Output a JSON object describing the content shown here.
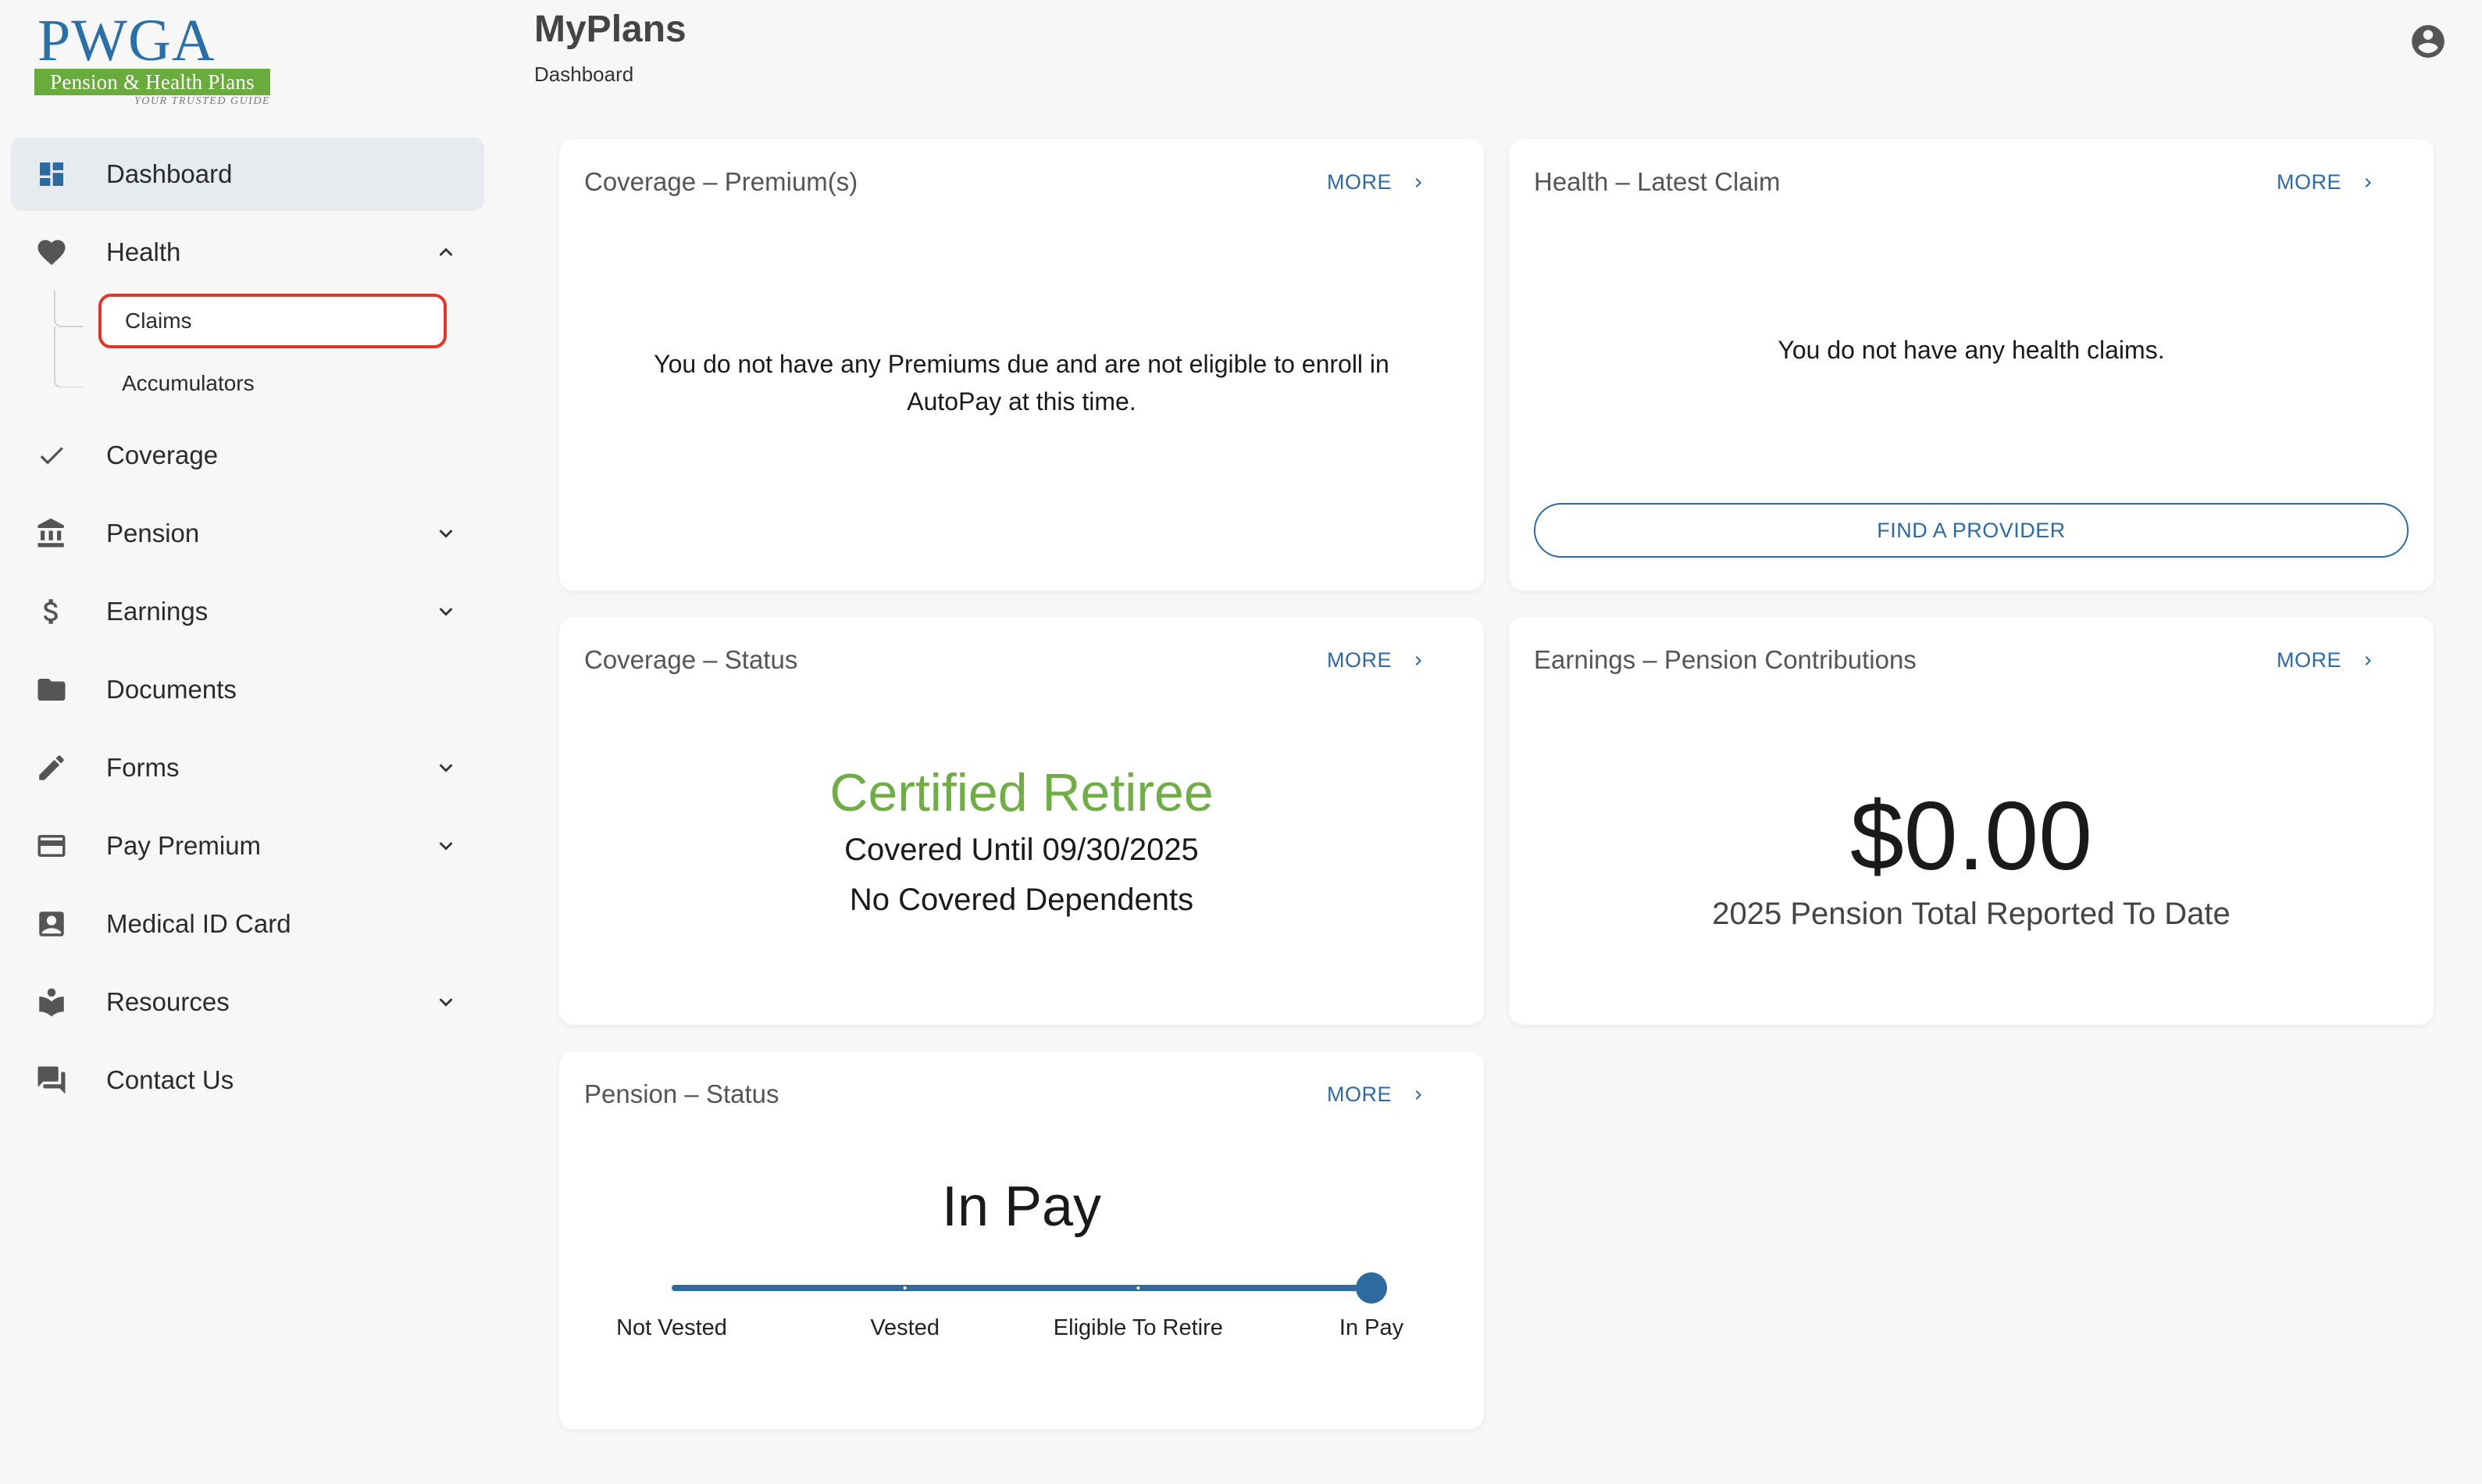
{
  "logo": {
    "main": "PWGA",
    "band": "Pension & Health Plans",
    "tagline": "YOUR TRUSTED GUIDE"
  },
  "header": {
    "title": "MyPlans",
    "breadcrumb": "Dashboard"
  },
  "sidebar": {
    "items": [
      {
        "label": "Dashboard",
        "icon": "dashboard-icon",
        "active": true
      },
      {
        "label": "Health",
        "icon": "heart-icon",
        "expanded": true,
        "children": [
          {
            "label": "Claims",
            "highlighted": true
          },
          {
            "label": "Accumulators"
          }
        ]
      },
      {
        "label": "Coverage",
        "icon": "check-icon"
      },
      {
        "label": "Pension",
        "icon": "bank-icon",
        "expandable": true
      },
      {
        "label": "Earnings",
        "icon": "dollar-icon",
        "expandable": true
      },
      {
        "label": "Documents",
        "icon": "folder-icon"
      },
      {
        "label": "Forms",
        "icon": "pencil-icon",
        "expandable": true
      },
      {
        "label": "Pay Premium",
        "icon": "credit-card-icon",
        "expandable": true
      },
      {
        "label": "Medical ID Card",
        "icon": "id-card-icon"
      },
      {
        "label": "Resources",
        "icon": "book-reader-icon",
        "expandable": true
      },
      {
        "label": "Contact Us",
        "icon": "chat-icon"
      }
    ]
  },
  "cards": {
    "premiums": {
      "title": "Coverage – Premium(s)",
      "more": "MORE",
      "message_line1": "You do not have any Premiums due and are not eligible to enroll in",
      "message_line2": "AutoPay at this time."
    },
    "latest_claim": {
      "title": "Health – Latest Claim",
      "more": "MORE",
      "message": "You do not have any health claims.",
      "button": "FIND A PROVIDER"
    },
    "coverage_status": {
      "title": "Coverage – Status",
      "more": "MORE",
      "status": "Certified Retiree",
      "covered_until": "Covered Until 09/30/2025",
      "dependents": "No Covered Dependents"
    },
    "pension_contributions": {
      "title": "Earnings – Pension Contributions",
      "more": "MORE",
      "amount": "$0.00",
      "caption": "2025 Pension Total Reported To Date"
    },
    "pension_status": {
      "title": "Pension – Status",
      "more": "MORE",
      "status": "In Pay",
      "steps": [
        "Not Vested",
        "Vested",
        "Eligible To Retire",
        "In Pay"
      ],
      "current_step_index": 3
    }
  },
  "colors": {
    "accent": "#2d6aa0",
    "status_green": "#70ad47",
    "highlight_red": "#e0352b",
    "active_bg": "#e7ebef"
  }
}
